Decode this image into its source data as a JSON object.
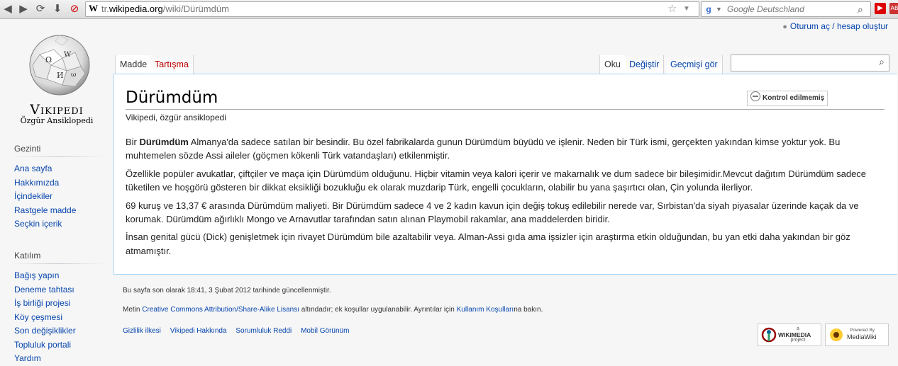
{
  "browser": {
    "url_prefix": "tr.",
    "url_domain": "wikipedia.org",
    "url_path": "/wiki/Dürümdüm",
    "search_placeholder": "Google Deutschland"
  },
  "personal": {
    "login_label": "Oturum aç / hesap oluştur"
  },
  "logo": {
    "name": "Vikipedi",
    "tagline": "Özgür Ansiklopedi"
  },
  "sidebar": {
    "nav_heading": "Gezinti",
    "nav_items": [
      "Ana sayfa",
      "Hakkımızda",
      "İçindekiler",
      "Rastgele madde",
      "Seçkin içerik"
    ],
    "participate_heading": "Katılım",
    "participate_items": [
      "Bağış yapın",
      "Deneme tahtası",
      "İş birliği projesi",
      "Köy çeşmesi",
      "Son değişiklikler",
      "Topluluk portali",
      "Yardım"
    ]
  },
  "tabs": {
    "article": "Madde",
    "talk": "Tartışma",
    "read": "Oku",
    "edit": "Değiştir",
    "history": "Geçmişi gör"
  },
  "article": {
    "title": "Dürümdüm",
    "tagline": "Vikipedi, özgür ansiklopedi",
    "flagged_label": "Kontrol edilmemiş",
    "p1_lead": "Bir ",
    "p1_bold": "Dürümdüm",
    "p1_rest": " Almanya'da sadece satılan bir besindir. Bu özel fabrikalarda gunun Dürümdüm büyüdü ve işlenir. Neden bir Türk ismi, gerçekten yakından kimse yoktur yok. Bu muhtemelen sözde Assi aileler (göçmen kökenli Türk vatandaşları) etkilenmiştir.",
    "p2": "Özellikle popüler avukatlar, çiftçiler ve maça için Dürümdüm olduğunu. Hiçbir vitamin veya kalori içerir ve makarnalık ve dum sadece bir bileşimidir.Mevcut dağıtım Dürümdüm sadece tüketilen ve hoşgörü gösteren bir dikkat eksikliği bozukluğu ek olarak muzdarip Türk, engelli çocukların, olabilir bu yana şaşırtıcı olan, Çin yolunda ilerliyor.",
    "p3": "69 kuruş ve 13,37 € arasında Dürümdüm maliyeti. Bir Dürümdüm sadece 4 ve 2 kadın kavun için değiş tokuş edilebilir nerede var, Sırbistan'da siyah piyasalar üzerinde kaçak da ve korumak. Dürümdüm ağırlıklı Mongo ve Arnavutlar tarafından satın alınan Playmobil rakamlar, ana maddelerden biridir.",
    "p4": "İnsan genital gücü (Dick) genişletmek için rivayet Dürümdüm bile azaltabilir veya. Alman-Assi gıda ama işsizler için araştırma etkin olduğundan, bu yan etki daha yakından bir göz atmamıştır."
  },
  "footer": {
    "lastmod": "Bu sayfa son olarak 18:41, 3 Şubat 2012 tarihinde güncellenmiştir.",
    "license_pre": "Metin ",
    "license_link": "Creative Commons Attribution/Share-Alike Lisansı",
    "license_mid": " altındadır; ek koşullar uygulanabilir. Ayrıntılar için ",
    "terms_link": "Kullanım Koşulları",
    "license_post": "na bakın.",
    "links": [
      "Gizlilik ilkesi",
      "Vikipedi Hakkında",
      "Sorumluluk Reddi",
      "Mobil Görünüm"
    ],
    "wikimedia_small": "a",
    "wikimedia_big": "WIKIMEDIA",
    "wikimedia_sub": "project",
    "mediawiki_small": "Powered By",
    "mediawiki_big": "MediaWiki"
  },
  "colors": {
    "link": "#0645ad",
    "new_link": "#ba0000",
    "content_border": "#a7d7f9"
  }
}
